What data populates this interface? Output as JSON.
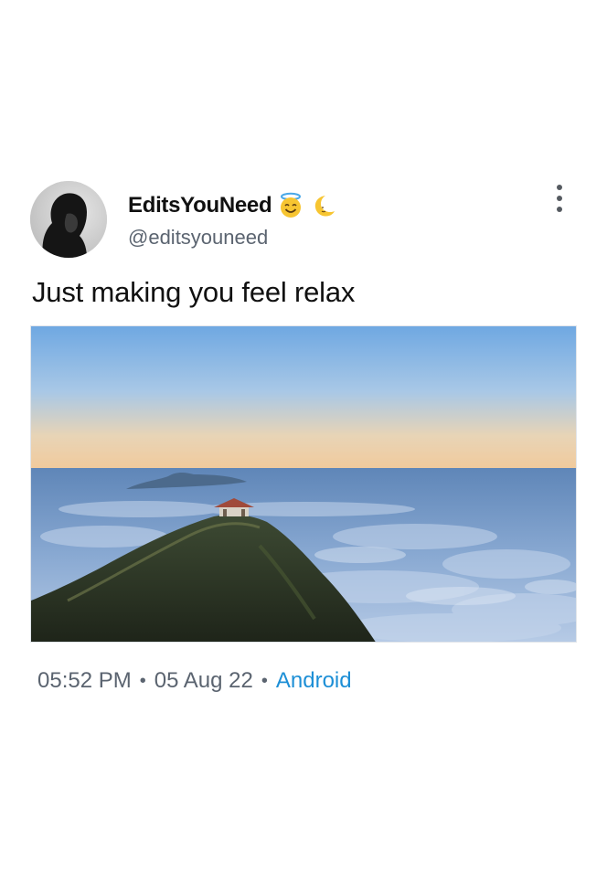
{
  "tweet": {
    "display_name": "EditsYouNeed",
    "name_emojis": [
      "smiling-face-with-halo-emoji",
      "crescent-moon-emoji"
    ],
    "handle": "@editsyouneed",
    "text": "Just making you feel relax",
    "time": "05:52 PM",
    "date": "05 Aug 22",
    "separator": "•",
    "source": "Android",
    "more_icon": "more-vertical-icon"
  },
  "colors": {
    "name": "#111111",
    "secondary_text": "#5b6470",
    "link": "#1d8fd6",
    "background": "#ffffff"
  }
}
